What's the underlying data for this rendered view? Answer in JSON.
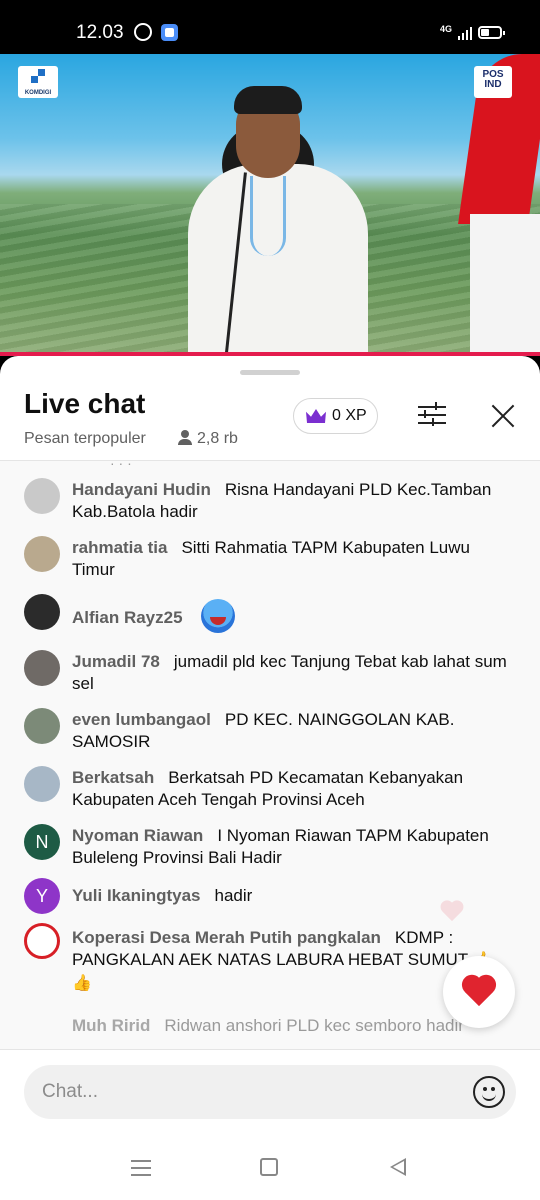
{
  "status_bar": {
    "time": "12.03",
    "network": "4G"
  },
  "video": {
    "logo_left_label": "KOMDIGI",
    "logo_right_label": "POS IND"
  },
  "chat_header": {
    "title": "Live chat",
    "mode": "Pesan terpopuler",
    "viewers": "2,8 rb",
    "xp": "0 XP"
  },
  "messages": [
    {
      "author": "Handayani Hudin",
      "text": "Risna Handayani PLD Kec.Tamban Kab.Batola hadir",
      "avatar_color": "#c9c9c9",
      "avatar_letter": ""
    },
    {
      "author": "rahmatia tia",
      "text": "Sitti Rahmatia TAPM Kabupaten Luwu Timur",
      "avatar_color": "#b9a98e",
      "avatar_letter": ""
    },
    {
      "author": "Alfian Rayz25",
      "text": "",
      "avatar_color": "#2b2b2b",
      "avatar_letter": ""
    },
    {
      "author": "Jumadil 78",
      "text": "jumadil pld kec Tanjung Tebat kab lahat sum sel",
      "avatar_color": "#6f6a66",
      "avatar_letter": ""
    },
    {
      "author": "even lumbangaol",
      "text": "PD KEC. NAINGGOLAN KAB. SAMOSIR",
      "avatar_color": "#7c8a78",
      "avatar_letter": ""
    },
    {
      "author": "Berkatsah",
      "text": "Berkatsah PD Kecamatan Kebanyakan Kabupaten Aceh Tengah Provinsi Aceh",
      "avatar_color": "#a7b7c6",
      "avatar_letter": ""
    },
    {
      "author": "Nyoman Riawan",
      "text": "I Nyoman Riawan TAPM Kabupaten Buleleng Provinsi Bali Hadir",
      "avatar_color": "#1e5b45",
      "avatar_letter": "N"
    },
    {
      "author": "Yuli Ikaningtyas",
      "text": "hadir",
      "avatar_color": "#8e35c8",
      "avatar_letter": "Y"
    },
    {
      "author": "Koperasi Desa Merah Putih pangkalan",
      "text": "KDMP : PANGKALAN AEK NATAS LABURA HEBAT SUMUT",
      "avatar_color": "#d71f26",
      "avatar_letter": ""
    },
    {
      "author": "Muh Ririd",
      "text": "Ridwan anshori PLD kec semboro hadir",
      "avatar_color": "",
      "avatar_letter": ""
    }
  ],
  "input": {
    "placeholder": "Chat..."
  }
}
